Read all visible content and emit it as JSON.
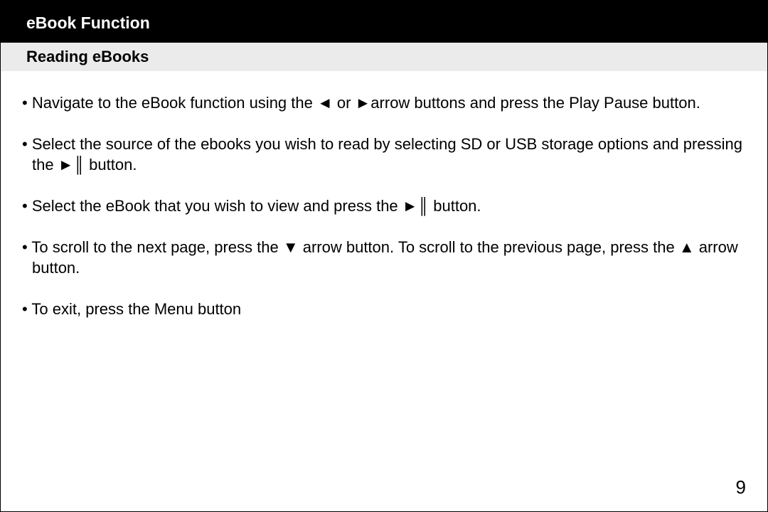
{
  "header": {
    "title": "eBook Function"
  },
  "subheader": {
    "title": "Reading eBooks"
  },
  "bullets": [
    "• Navigate to the eBook function using the ◄ or ►arrow buttons and press the Play Pause button.",
    "• Select the source of the ebooks you wish to read by selecting SD or USB storage options and pressing the ►║ button.",
    "• Select the eBook that you wish to view and press the ►║ button.",
    "• To scroll to the next page, press the ▼ arrow button. To scroll to the previous page, press the ▲ arrow button.",
    "• To exit, press the Menu button"
  ],
  "pageNumber": "9"
}
